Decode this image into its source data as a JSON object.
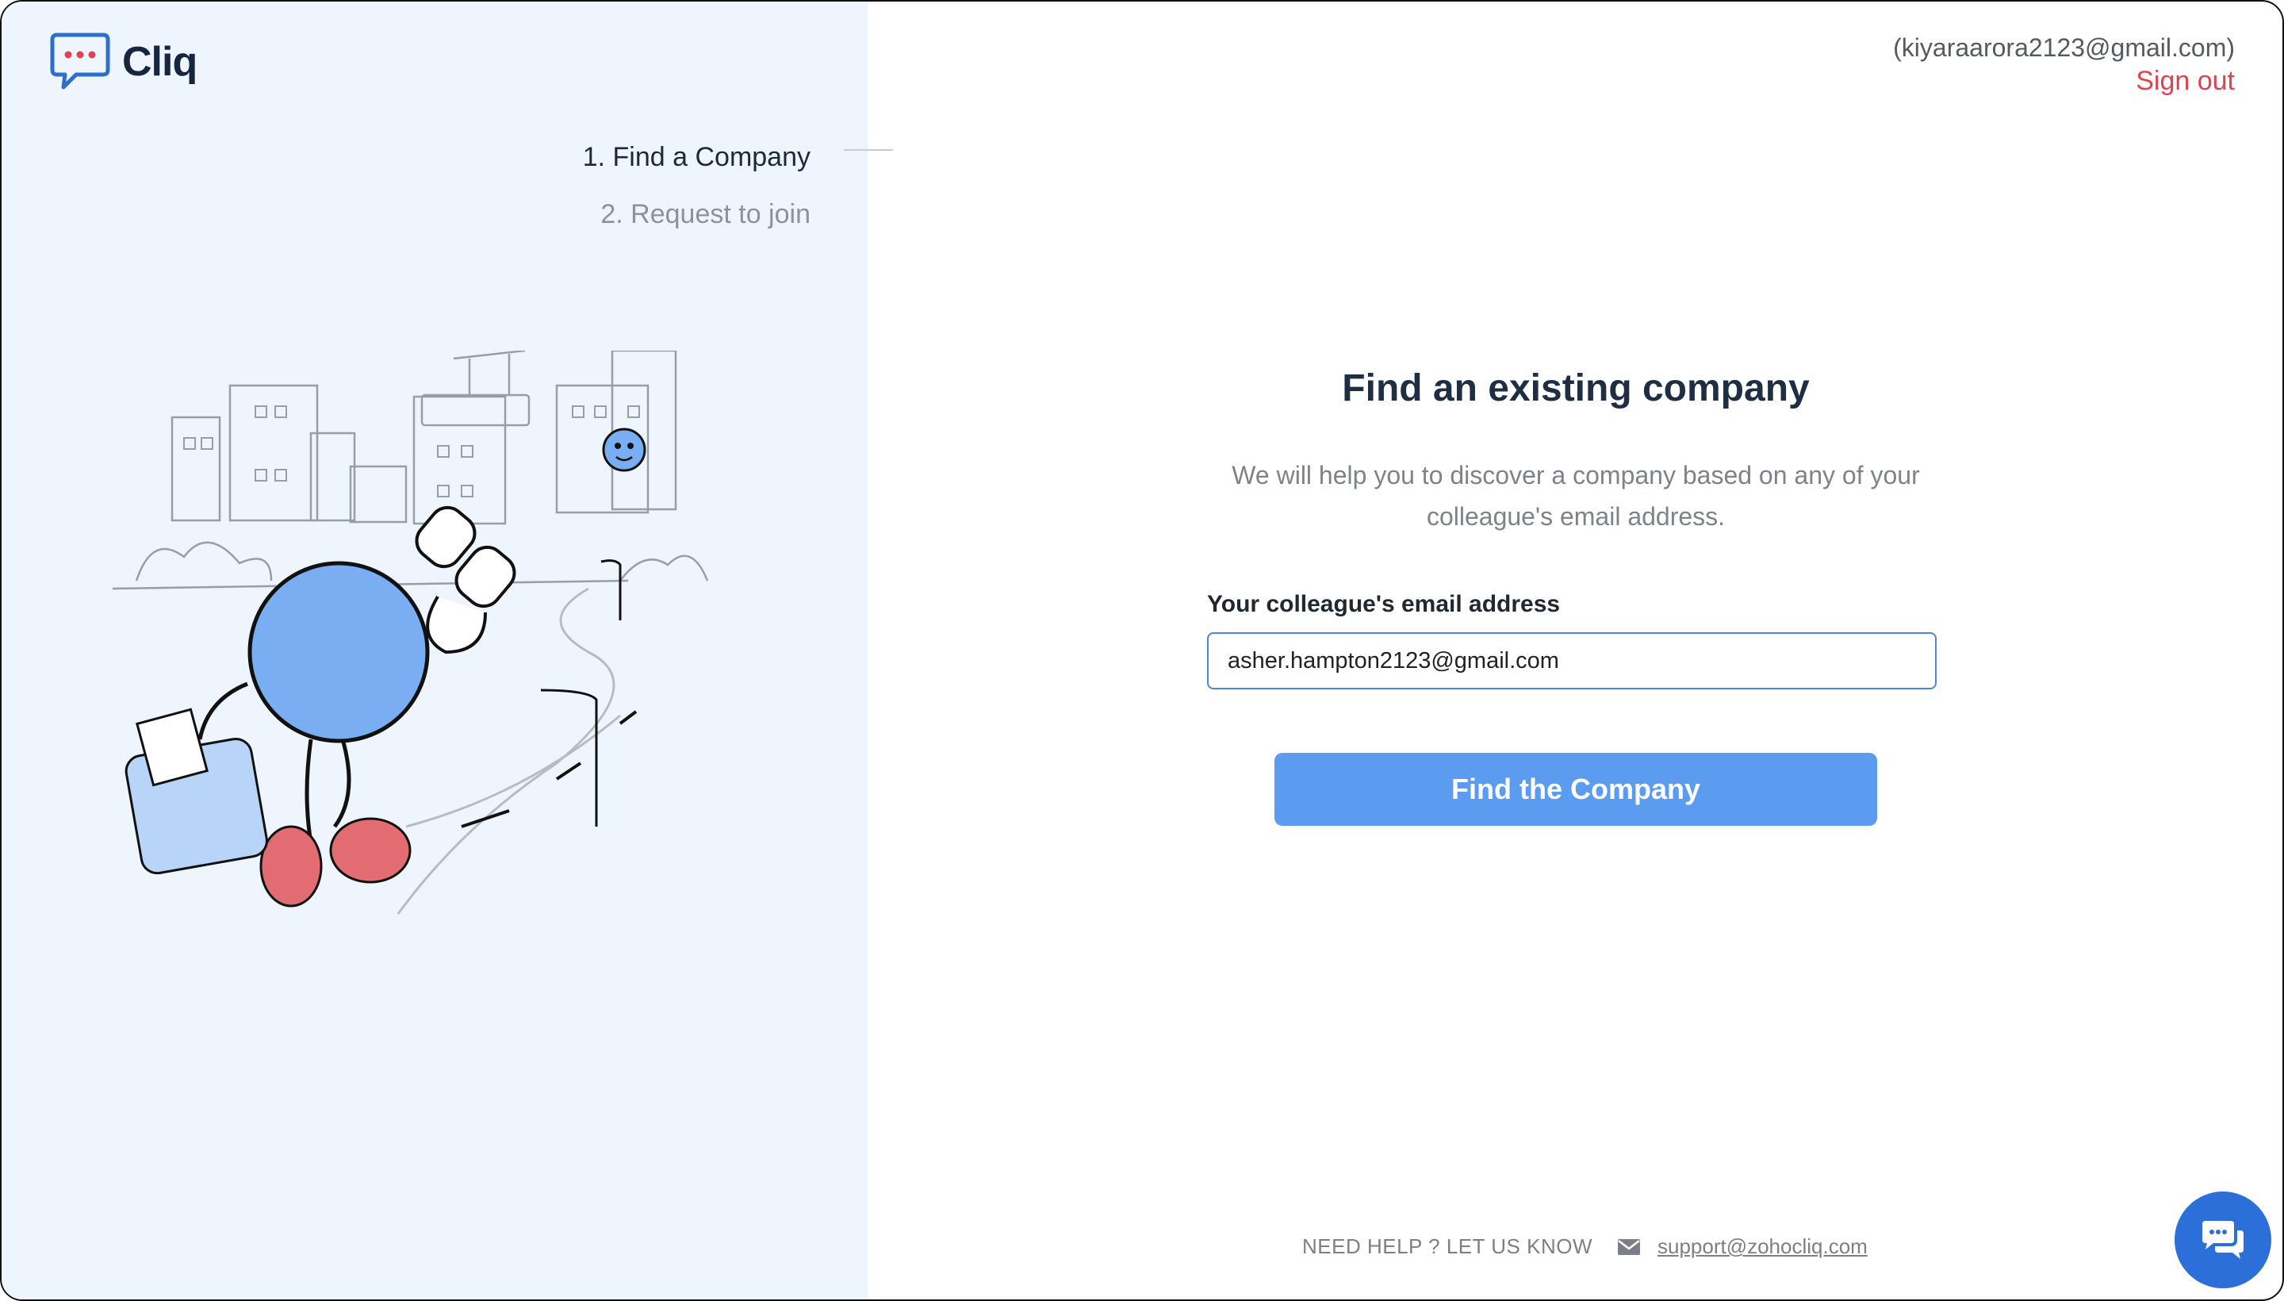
{
  "app": {
    "name": "Cliq"
  },
  "account": {
    "email": "(kiyaraarora2123@gmail.com)",
    "sign_out": "Sign out"
  },
  "steps": [
    {
      "label": "1. Find a Company",
      "state": "active"
    },
    {
      "label": "2. Request to join",
      "state": "inactive"
    }
  ],
  "main": {
    "heading": "Find an existing company",
    "description_line1": "We will help you to discover a company based on any of your",
    "description_line2": "colleague's email address.",
    "field_label": "Your colleague's email address",
    "email_value": "asher.hampton2123@gmail.com",
    "button_label": "Find the Company"
  },
  "footer": {
    "help_text": "NEED HELP ? LET US KNOW",
    "support_email": "support@zohocliq.com"
  },
  "icons": {
    "logo": "chat-bubble-dots-icon",
    "mail": "envelope-icon",
    "chat": "chat-widget-icon"
  },
  "colors": {
    "left_pane_bg": "#eef5fd",
    "accent_button": "#5b9bf0",
    "sign_out": "#e2424f",
    "chat_widget": "#2c6fd8",
    "heading": "#1e2f44"
  }
}
